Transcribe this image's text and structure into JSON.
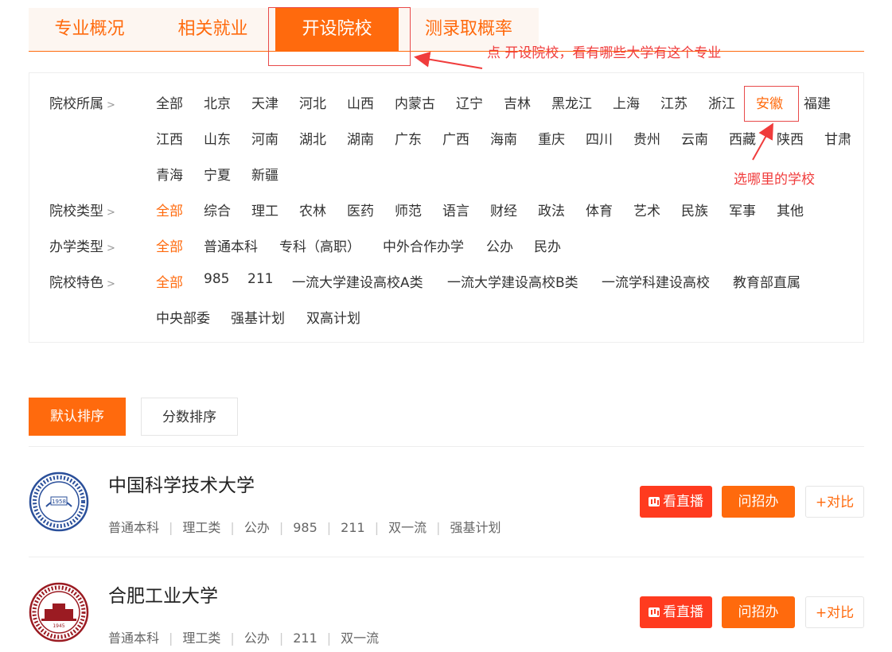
{
  "tabs": [
    "专业概况",
    "相关就业",
    "开设院校",
    "测录取概率"
  ],
  "annotations": {
    "click_hint": "点 开设院校，看有哪些大学有这个专业",
    "select_hint": "选哪里的学校"
  },
  "filters": {
    "region": {
      "label": "院校所属",
      "options": [
        "全部",
        "北京",
        "天津",
        "河北",
        "山西",
        "内蒙古",
        "辽宁",
        "吉林",
        "黑龙江",
        "上海",
        "江苏",
        "浙江",
        "安徽",
        "福建",
        "江西",
        "山东",
        "河南",
        "湖北",
        "湖南",
        "广东",
        "广西",
        "海南",
        "重庆",
        "四川",
        "贵州",
        "云南",
        "西藏",
        "陕西",
        "甘肃",
        "青海",
        "宁夏",
        "新疆"
      ],
      "selected": "安徽"
    },
    "type": {
      "label": "院校类型",
      "options": [
        "全部",
        "综合",
        "理工",
        "农林",
        "医药",
        "师范",
        "语言",
        "财经",
        "政法",
        "体育",
        "艺术",
        "民族",
        "军事",
        "其他"
      ],
      "selected": "全部"
    },
    "run": {
      "label": "办学类型",
      "options": [
        "全部",
        "普通本科",
        "专科（高职）",
        "中外合作办学",
        "公办",
        "民办"
      ],
      "selected": "全部"
    },
    "feature": {
      "label": "院校特色",
      "options": [
        "全部",
        "985",
        "211",
        "一流大学建设高校A类",
        "一流大学建设高校B类",
        "一流学科建设高校",
        "教育部直属",
        "中央部委",
        "强基计划",
        "双高计划"
      ],
      "selected": "全部"
    }
  },
  "sort": {
    "default": "默认排序",
    "score": "分数排序"
  },
  "universities": [
    {
      "name": "中国科学技术大学",
      "tags": [
        "普通本科",
        "理工类",
        "公办",
        "985",
        "211",
        "双一流",
        "强基计划"
      ],
      "logo_text": "1958"
    },
    {
      "name": "合肥工业大学",
      "tags": [
        "普通本科",
        "理工类",
        "公办",
        "211",
        "双一流"
      ],
      "logo_text": "1945"
    }
  ],
  "buttons": {
    "live": "看直播",
    "ask": "问招办",
    "compare": "+对比"
  },
  "colors": {
    "accent": "#ff6a0d",
    "live": "#ff3b1f",
    "annotation": "#f03c3c",
    "ustc_blue": "#2a4f9a",
    "hfut_red": "#9b1b22"
  }
}
